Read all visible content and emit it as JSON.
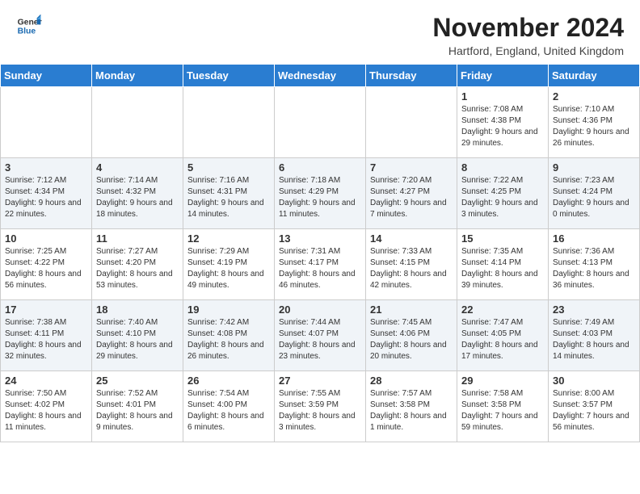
{
  "header": {
    "logo_general": "General",
    "logo_blue": "Blue",
    "month_year": "November 2024",
    "location": "Hartford, England, United Kingdom"
  },
  "days_of_week": [
    "Sunday",
    "Monday",
    "Tuesday",
    "Wednesday",
    "Thursday",
    "Friday",
    "Saturday"
  ],
  "weeks": [
    [
      {
        "day": "",
        "info": ""
      },
      {
        "day": "",
        "info": ""
      },
      {
        "day": "",
        "info": ""
      },
      {
        "day": "",
        "info": ""
      },
      {
        "day": "",
        "info": ""
      },
      {
        "day": "1",
        "info": "Sunrise: 7:08 AM\nSunset: 4:38 PM\nDaylight: 9 hours and 29 minutes."
      },
      {
        "day": "2",
        "info": "Sunrise: 7:10 AM\nSunset: 4:36 PM\nDaylight: 9 hours and 26 minutes."
      }
    ],
    [
      {
        "day": "3",
        "info": "Sunrise: 7:12 AM\nSunset: 4:34 PM\nDaylight: 9 hours and 22 minutes."
      },
      {
        "day": "4",
        "info": "Sunrise: 7:14 AM\nSunset: 4:32 PM\nDaylight: 9 hours and 18 minutes."
      },
      {
        "day": "5",
        "info": "Sunrise: 7:16 AM\nSunset: 4:31 PM\nDaylight: 9 hours and 14 minutes."
      },
      {
        "day": "6",
        "info": "Sunrise: 7:18 AM\nSunset: 4:29 PM\nDaylight: 9 hours and 11 minutes."
      },
      {
        "day": "7",
        "info": "Sunrise: 7:20 AM\nSunset: 4:27 PM\nDaylight: 9 hours and 7 minutes."
      },
      {
        "day": "8",
        "info": "Sunrise: 7:22 AM\nSunset: 4:25 PM\nDaylight: 9 hours and 3 minutes."
      },
      {
        "day": "9",
        "info": "Sunrise: 7:23 AM\nSunset: 4:24 PM\nDaylight: 9 hours and 0 minutes."
      }
    ],
    [
      {
        "day": "10",
        "info": "Sunrise: 7:25 AM\nSunset: 4:22 PM\nDaylight: 8 hours and 56 minutes."
      },
      {
        "day": "11",
        "info": "Sunrise: 7:27 AM\nSunset: 4:20 PM\nDaylight: 8 hours and 53 minutes."
      },
      {
        "day": "12",
        "info": "Sunrise: 7:29 AM\nSunset: 4:19 PM\nDaylight: 8 hours and 49 minutes."
      },
      {
        "day": "13",
        "info": "Sunrise: 7:31 AM\nSunset: 4:17 PM\nDaylight: 8 hours and 46 minutes."
      },
      {
        "day": "14",
        "info": "Sunrise: 7:33 AM\nSunset: 4:15 PM\nDaylight: 8 hours and 42 minutes."
      },
      {
        "day": "15",
        "info": "Sunrise: 7:35 AM\nSunset: 4:14 PM\nDaylight: 8 hours and 39 minutes."
      },
      {
        "day": "16",
        "info": "Sunrise: 7:36 AM\nSunset: 4:13 PM\nDaylight: 8 hours and 36 minutes."
      }
    ],
    [
      {
        "day": "17",
        "info": "Sunrise: 7:38 AM\nSunset: 4:11 PM\nDaylight: 8 hours and 32 minutes."
      },
      {
        "day": "18",
        "info": "Sunrise: 7:40 AM\nSunset: 4:10 PM\nDaylight: 8 hours and 29 minutes."
      },
      {
        "day": "19",
        "info": "Sunrise: 7:42 AM\nSunset: 4:08 PM\nDaylight: 8 hours and 26 minutes."
      },
      {
        "day": "20",
        "info": "Sunrise: 7:44 AM\nSunset: 4:07 PM\nDaylight: 8 hours and 23 minutes."
      },
      {
        "day": "21",
        "info": "Sunrise: 7:45 AM\nSunset: 4:06 PM\nDaylight: 8 hours and 20 minutes."
      },
      {
        "day": "22",
        "info": "Sunrise: 7:47 AM\nSunset: 4:05 PM\nDaylight: 8 hours and 17 minutes."
      },
      {
        "day": "23",
        "info": "Sunrise: 7:49 AM\nSunset: 4:03 PM\nDaylight: 8 hours and 14 minutes."
      }
    ],
    [
      {
        "day": "24",
        "info": "Sunrise: 7:50 AM\nSunset: 4:02 PM\nDaylight: 8 hours and 11 minutes."
      },
      {
        "day": "25",
        "info": "Sunrise: 7:52 AM\nSunset: 4:01 PM\nDaylight: 8 hours and 9 minutes."
      },
      {
        "day": "26",
        "info": "Sunrise: 7:54 AM\nSunset: 4:00 PM\nDaylight: 8 hours and 6 minutes."
      },
      {
        "day": "27",
        "info": "Sunrise: 7:55 AM\nSunset: 3:59 PM\nDaylight: 8 hours and 3 minutes."
      },
      {
        "day": "28",
        "info": "Sunrise: 7:57 AM\nSunset: 3:58 PM\nDaylight: 8 hours and 1 minute."
      },
      {
        "day": "29",
        "info": "Sunrise: 7:58 AM\nSunset: 3:58 PM\nDaylight: 7 hours and 59 minutes."
      },
      {
        "day": "30",
        "info": "Sunrise: 8:00 AM\nSunset: 3:57 PM\nDaylight: 7 hours and 56 minutes."
      }
    ]
  ]
}
